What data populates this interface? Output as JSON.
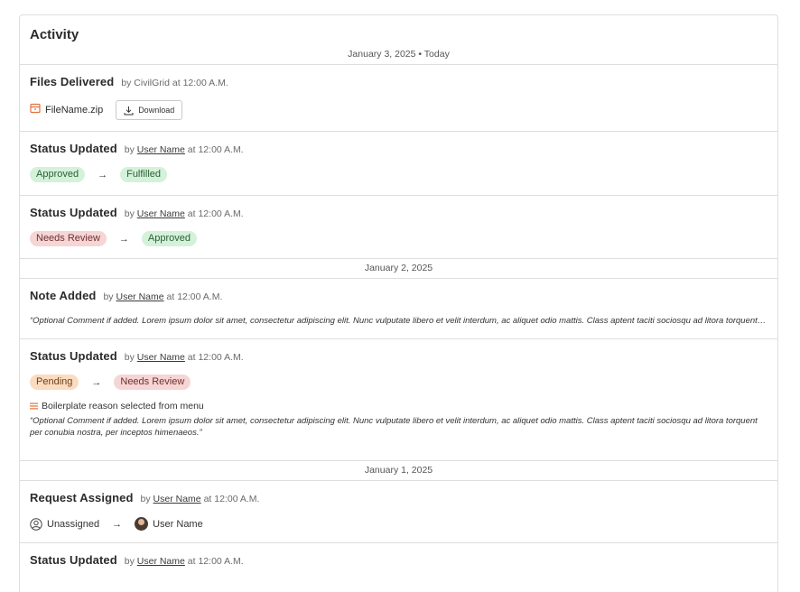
{
  "title": "Activity",
  "groups": [
    {
      "date": "January 3, 2025 • Today",
      "events": [
        {
          "title": "Files Delivered",
          "by_prefix": "by",
          "by_name": "CivilGrid",
          "time": "at 12:00 A.M.",
          "file_name": "FileName.zip",
          "download_label": "Download"
        },
        {
          "title": "Status Updated",
          "by_prefix": "by",
          "by_name": "User Name",
          "time": "at 12:00 A.M.",
          "from": "Approved",
          "to": "Fulfilled"
        },
        {
          "title": "Status Updated",
          "by_prefix": "by",
          "by_name": "User Name",
          "time": "at 12:00 A.M.",
          "from": "Needs Review",
          "to": "Approved"
        }
      ]
    },
    {
      "date": "January 2, 2025",
      "events": [
        {
          "title": "Note Added",
          "by_prefix": "by",
          "by_name": "User Name",
          "time": "at 12:00 A.M.",
          "comment": "“Optional Comment if added. Lorem ipsum dolor sit amet, consectetur adipiscing elit. Nunc vulputate libero et velit interdum, ac aliquet odio mattis. Class aptent taciti sociosqu ad litora torquent per conubia nostra, per inceptos himenaeos.”"
        },
        {
          "title": "Status Updated",
          "by_prefix": "by",
          "by_name": "User Name",
          "time": "at 12:00 A.M.",
          "from": "Pending",
          "to": "Needs Review",
          "reason": "Boilerplate reason selected from menu",
          "comment": "“Optional Comment if added. Lorem ipsum dolor sit amet, consectetur adipiscing elit. Nunc vulputate libero et velit interdum, ac aliquet odio mattis. Class aptent taciti sociosqu ad litora torquent per conubia nostra, per inceptos himenaeos.”"
        }
      ]
    },
    {
      "date": "January 1, 2025",
      "events": [
        {
          "title": "Request Assigned",
          "by_prefix": "by",
          "by_name": "User Name",
          "time": "at 12:00 A.M.",
          "from": "Unassigned",
          "to": "User Name"
        },
        {
          "title": "Status Updated",
          "by_prefix": "by",
          "by_name": "User Name",
          "time": "at 12:00 A.M."
        }
      ]
    }
  ],
  "arrow": "→",
  "colors": {
    "approved": "#d3f2d9",
    "fulfilled": "#d3f2d9",
    "needs_review": "#f6d5d5",
    "pending": "#fbdcc0",
    "border": "#dedede"
  },
  "icons": {
    "file": "file-icon",
    "download": "download-icon",
    "reason": "list-icon",
    "unassigned": "user-circle-icon",
    "assignee": "avatar"
  }
}
